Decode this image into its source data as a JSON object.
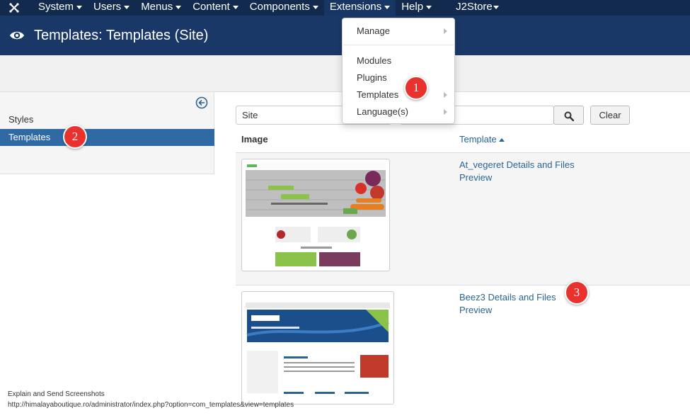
{
  "navbar": {
    "items": [
      {
        "label": "System"
      },
      {
        "label": "Users"
      },
      {
        "label": "Menus"
      },
      {
        "label": "Content"
      },
      {
        "label": "Components"
      },
      {
        "label": "Extensions"
      },
      {
        "label": "Help"
      },
      {
        "label": "J2Store"
      }
    ]
  },
  "header": {
    "title": "Templates: Templates (Site)",
    "icon": "eye-icon"
  },
  "extensions_menu": {
    "items": [
      {
        "label": "Manage",
        "submenu": true
      },
      {
        "label": "Modules",
        "submenu": false
      },
      {
        "label": "Plugins",
        "submenu": false
      },
      {
        "label": "Templates",
        "submenu": true
      },
      {
        "label": "Language(s)",
        "submenu": true
      }
    ]
  },
  "sidebar": {
    "items": [
      {
        "label": "Styles",
        "active": false
      },
      {
        "label": "Templates",
        "active": true
      }
    ]
  },
  "filters": {
    "client_value": "Site",
    "search_value": "",
    "search_icon": "search-icon",
    "clear_label": "Clear"
  },
  "table": {
    "columns": {
      "image": "Image",
      "template": "Template"
    },
    "rows": [
      {
        "details": "At_vegeret Details and Files",
        "preview": "Preview"
      },
      {
        "details": "Beez3 Details and Files",
        "preview": "Preview"
      }
    ]
  },
  "markers": [
    "1",
    "2",
    "3"
  ],
  "overlay": {
    "line1": "Explain and Send Screenshots",
    "line2": "http://himalayaboutique.ro/administrator/index.php?option=com_templates&view=templates"
  },
  "colors": {
    "navbar": "#112a4e",
    "titlebar": "#1a3867",
    "sidebar_active": "#2f6aa5",
    "link": "#2a6496",
    "marker": "#e9322d"
  }
}
